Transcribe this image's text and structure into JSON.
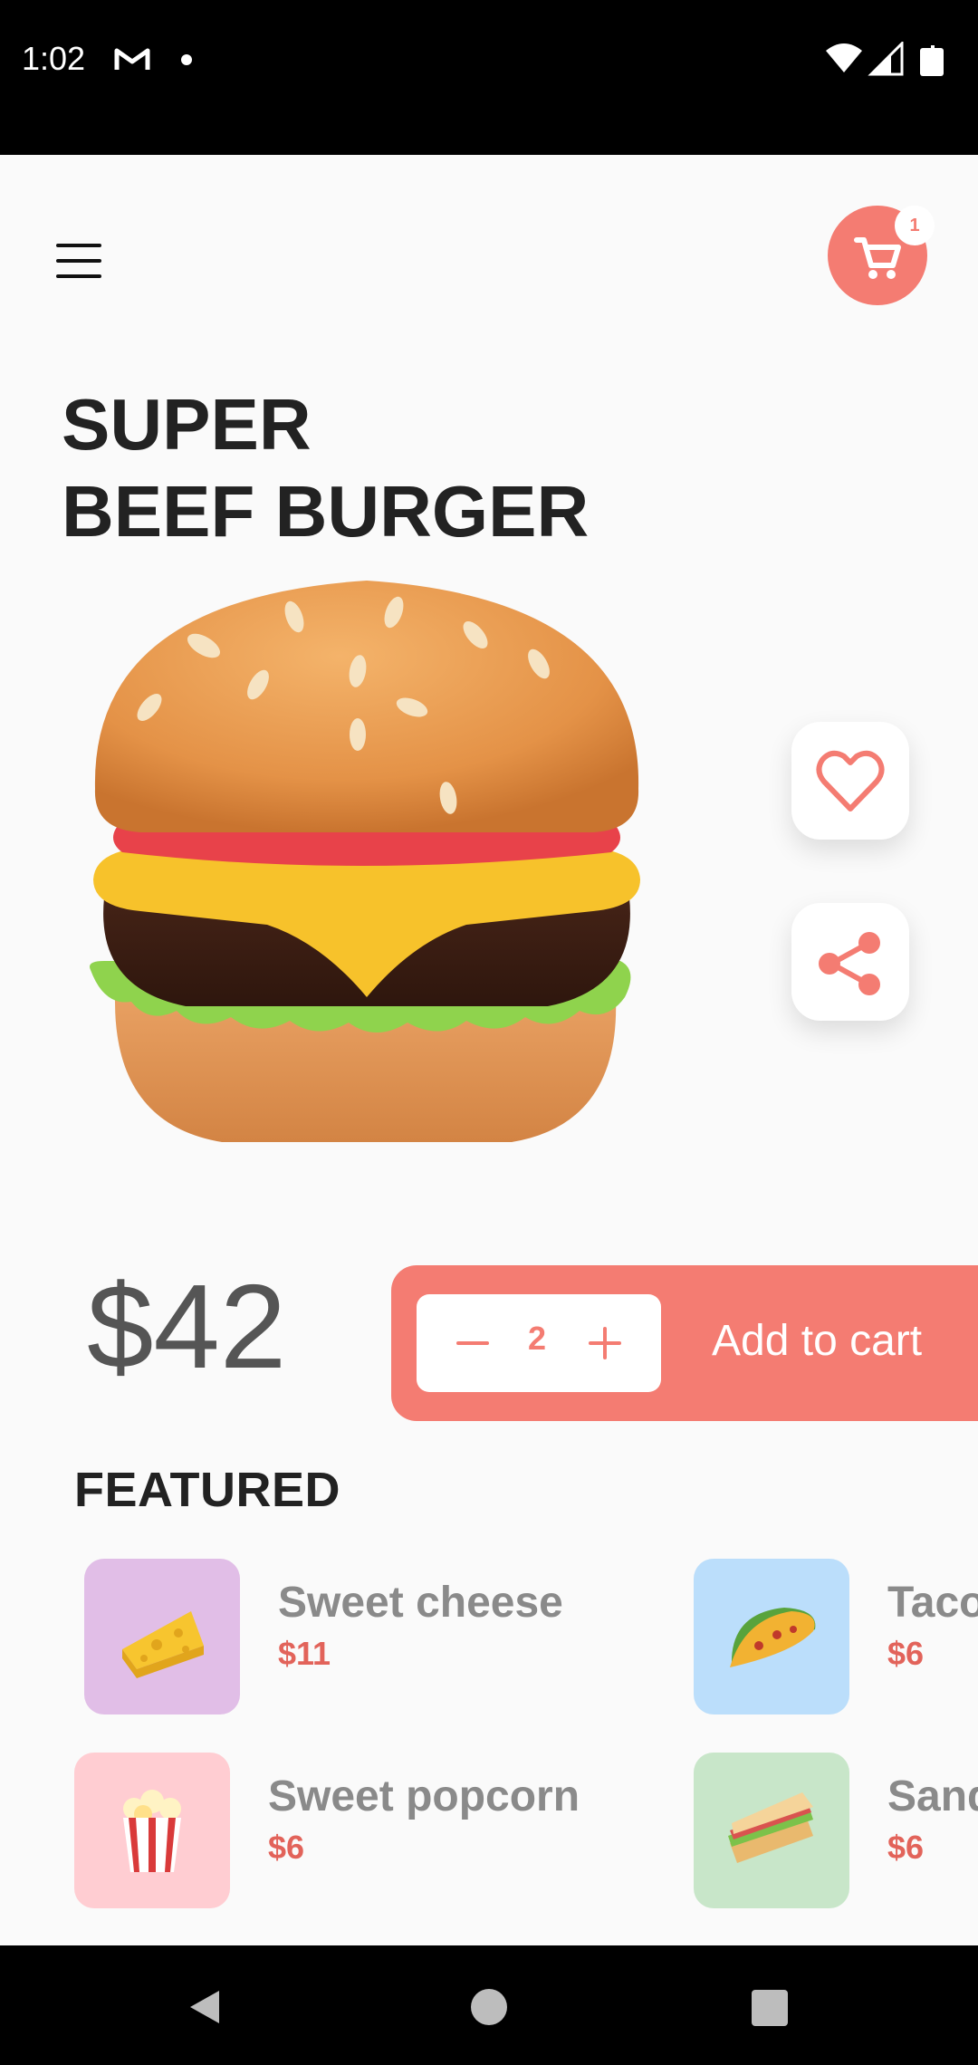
{
  "status_bar": {
    "time": "1:02",
    "icons": [
      "gmail-icon",
      "notification-dot-icon",
      "wifi-icon",
      "signal-icon",
      "battery-icon"
    ]
  },
  "header": {
    "menu_icon": "hamburger-menu-icon",
    "cart_icon": "shopping-cart-icon",
    "cart_count": "1"
  },
  "product": {
    "title_line1": "SUPER",
    "title_line2": "BEEF BURGER",
    "price": "$42",
    "image_icon": "burger-icon"
  },
  "actions": {
    "favorite_icon": "heart-icon",
    "share_icon": "share-icon"
  },
  "purchase": {
    "quantity": "2",
    "add_label": "Add to cart"
  },
  "featured": {
    "title": "FEATURED",
    "items": [
      {
        "name": "Sweet cheese",
        "price": "$11",
        "icon": "cheese-icon",
        "bg": "#e1bee7"
      },
      {
        "name": "Taco",
        "price": "$6",
        "icon": "taco-icon",
        "bg": "#bbdefb"
      },
      {
        "name": "Sweet popcorn",
        "price": "$6",
        "icon": "popcorn-icon",
        "bg": "#ffcdd2"
      },
      {
        "name": "Sandwich",
        "price": "$6",
        "icon": "sandwich-icon",
        "bg": "#c8e6c9"
      }
    ]
  },
  "colors": {
    "accent": "#f47c72",
    "price_red": "#e2635a",
    "background": "#fafafa"
  }
}
